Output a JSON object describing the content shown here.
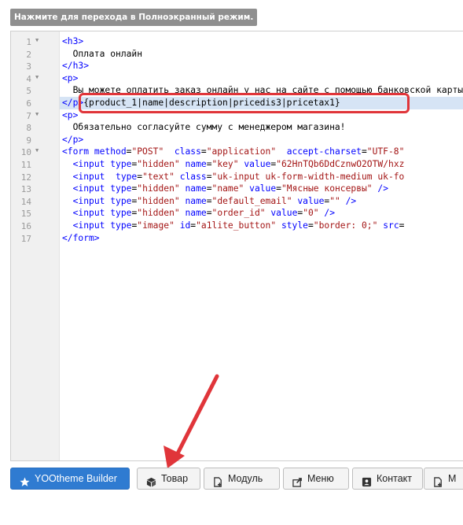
{
  "fullscreen_tip": "Нажмите для перехода в Полноэкранный режим.",
  "editor": {
    "line_numbers": [
      "1",
      "2",
      "3",
      "4",
      "5",
      "6",
      "7",
      "8",
      "9",
      "10",
      "11",
      "12",
      "13",
      "14",
      "15",
      "16",
      "17"
    ],
    "highlighted_line": 6,
    "lines": [
      [
        {
          "c": "tag",
          "t": "<h3>"
        }
      ],
      [
        {
          "c": "txt",
          "t": "  Оплата онлайн"
        }
      ],
      [
        {
          "c": "tag",
          "t": "</h3>"
        }
      ],
      [
        {
          "c": "tag",
          "t": "<p>"
        }
      ],
      [
        {
          "c": "txt",
          "t": "  Вы можете оплатить заказ онлайн у нас на сайте с помощью банковской карты"
        }
      ],
      [
        {
          "c": "tag",
          "t": "</p>"
        },
        {
          "c": "txt",
          "t": "{product_1|name|description|pricedis3|pricetax1}"
        }
      ],
      [
        {
          "c": "tag",
          "t": "<p>"
        }
      ],
      [
        {
          "c": "txt",
          "t": "  Обязательно согласуйте сумму с менеджером магазина!"
        }
      ],
      [
        {
          "c": "tag",
          "t": "</p>"
        }
      ],
      [
        {
          "c": "tag",
          "t": "<form"
        },
        {
          "c": "txt",
          "t": " "
        },
        {
          "c": "attr",
          "t": "method"
        },
        {
          "c": "txt",
          "t": "="
        },
        {
          "c": "str",
          "t": "\"POST\""
        },
        {
          "c": "txt",
          "t": "  "
        },
        {
          "c": "attr",
          "t": "class"
        },
        {
          "c": "txt",
          "t": "="
        },
        {
          "c": "str",
          "t": "\"application\""
        },
        {
          "c": "txt",
          "t": "  "
        },
        {
          "c": "attr",
          "t": "accept-charset"
        },
        {
          "c": "txt",
          "t": "="
        },
        {
          "c": "str",
          "t": "\"UTF-8\""
        }
      ],
      [
        {
          "c": "txt",
          "t": "  "
        },
        {
          "c": "tag",
          "t": "<input"
        },
        {
          "c": "txt",
          "t": " "
        },
        {
          "c": "attr",
          "t": "type"
        },
        {
          "c": "txt",
          "t": "="
        },
        {
          "c": "str",
          "t": "\"hidden\""
        },
        {
          "c": "txt",
          "t": " "
        },
        {
          "c": "attr",
          "t": "name"
        },
        {
          "c": "txt",
          "t": "="
        },
        {
          "c": "str",
          "t": "\"key\""
        },
        {
          "c": "txt",
          "t": " "
        },
        {
          "c": "attr",
          "t": "value"
        },
        {
          "c": "txt",
          "t": "="
        },
        {
          "c": "str",
          "t": "\"62HnTQb6DdCznwO2OTW/hxz"
        }
      ],
      [
        {
          "c": "txt",
          "t": "  "
        },
        {
          "c": "tag",
          "t": "<input"
        },
        {
          "c": "txt",
          "t": "  "
        },
        {
          "c": "attr",
          "t": "type"
        },
        {
          "c": "txt",
          "t": "="
        },
        {
          "c": "str",
          "t": "\"text\""
        },
        {
          "c": "txt",
          "t": " "
        },
        {
          "c": "attr",
          "t": "class"
        },
        {
          "c": "txt",
          "t": "="
        },
        {
          "c": "str",
          "t": "\"uk-input uk-form-width-medium uk-fo"
        }
      ],
      [
        {
          "c": "txt",
          "t": "  "
        },
        {
          "c": "tag",
          "t": "<input"
        },
        {
          "c": "txt",
          "t": " "
        },
        {
          "c": "attr",
          "t": "type"
        },
        {
          "c": "txt",
          "t": "="
        },
        {
          "c": "str",
          "t": "\"hidden\""
        },
        {
          "c": "txt",
          "t": " "
        },
        {
          "c": "attr",
          "t": "name"
        },
        {
          "c": "txt",
          "t": "="
        },
        {
          "c": "str",
          "t": "\"name\""
        },
        {
          "c": "txt",
          "t": " "
        },
        {
          "c": "attr",
          "t": "value"
        },
        {
          "c": "txt",
          "t": "="
        },
        {
          "c": "str",
          "t": "\"Мясные консервы\""
        },
        {
          "c": "txt",
          "t": " "
        },
        {
          "c": "tag",
          "t": "/>"
        }
      ],
      [
        {
          "c": "txt",
          "t": "  "
        },
        {
          "c": "tag",
          "t": "<input"
        },
        {
          "c": "txt",
          "t": " "
        },
        {
          "c": "attr",
          "t": "type"
        },
        {
          "c": "txt",
          "t": "="
        },
        {
          "c": "str",
          "t": "\"hidden\""
        },
        {
          "c": "txt",
          "t": " "
        },
        {
          "c": "attr",
          "t": "name"
        },
        {
          "c": "txt",
          "t": "="
        },
        {
          "c": "str",
          "t": "\"default_email\""
        },
        {
          "c": "txt",
          "t": " "
        },
        {
          "c": "attr",
          "t": "value"
        },
        {
          "c": "txt",
          "t": "="
        },
        {
          "c": "str",
          "t": "\"\""
        },
        {
          "c": "txt",
          "t": " "
        },
        {
          "c": "tag",
          "t": "/>"
        }
      ],
      [
        {
          "c": "txt",
          "t": "  "
        },
        {
          "c": "tag",
          "t": "<input"
        },
        {
          "c": "txt",
          "t": " "
        },
        {
          "c": "attr",
          "t": "type"
        },
        {
          "c": "txt",
          "t": "="
        },
        {
          "c": "str",
          "t": "\"hidden\""
        },
        {
          "c": "txt",
          "t": " "
        },
        {
          "c": "attr",
          "t": "name"
        },
        {
          "c": "txt",
          "t": "="
        },
        {
          "c": "str",
          "t": "\"order_id\""
        },
        {
          "c": "txt",
          "t": " "
        },
        {
          "c": "attr",
          "t": "value"
        },
        {
          "c": "txt",
          "t": "="
        },
        {
          "c": "str",
          "t": "\"0\""
        },
        {
          "c": "txt",
          "t": " "
        },
        {
          "c": "tag",
          "t": "/>"
        }
      ],
      [
        {
          "c": "txt",
          "t": "  "
        },
        {
          "c": "tag",
          "t": "<input"
        },
        {
          "c": "txt",
          "t": " "
        },
        {
          "c": "attr",
          "t": "type"
        },
        {
          "c": "txt",
          "t": "="
        },
        {
          "c": "str",
          "t": "\"image\""
        },
        {
          "c": "txt",
          "t": " "
        },
        {
          "c": "attr",
          "t": "id"
        },
        {
          "c": "txt",
          "t": "="
        },
        {
          "c": "str",
          "t": "\"a1lite_button\""
        },
        {
          "c": "txt",
          "t": " "
        },
        {
          "c": "attr",
          "t": "style"
        },
        {
          "c": "txt",
          "t": "="
        },
        {
          "c": "str",
          "t": "\"border: 0;\""
        },
        {
          "c": "txt",
          "t": " "
        },
        {
          "c": "attr",
          "t": "src"
        },
        {
          "c": "txt",
          "t": "="
        }
      ],
      [
        {
          "c": "tag",
          "t": "</form>"
        }
      ]
    ],
    "foldable_lines": [
      1,
      4,
      7,
      10
    ]
  },
  "toolbar": {
    "buttons": [
      {
        "name": "yootheme-builder-button",
        "icon": "star-icon",
        "label": "YOOtheme Builder",
        "primary": true
      },
      {
        "name": "tovar-button",
        "icon": "cube-icon",
        "label": "Товар",
        "primary": false
      },
      {
        "name": "modul-button",
        "icon": "file-plus-icon",
        "label": "Модуль",
        "primary": false
      },
      {
        "name": "menu-button",
        "icon": "share-icon",
        "label": "Меню",
        "primary": false
      },
      {
        "name": "kontakt-button",
        "icon": "contact-card-icon",
        "label": "Контакт",
        "primary": false
      },
      {
        "name": "m-button",
        "icon": "file-plus-icon",
        "label": "М",
        "primary": false
      }
    ]
  },
  "colors": {
    "highlight_box": "#e0353a",
    "arrow": "#e0353a",
    "primary_button": "#2f7bd1",
    "selected_line": "#d6e4f5"
  }
}
